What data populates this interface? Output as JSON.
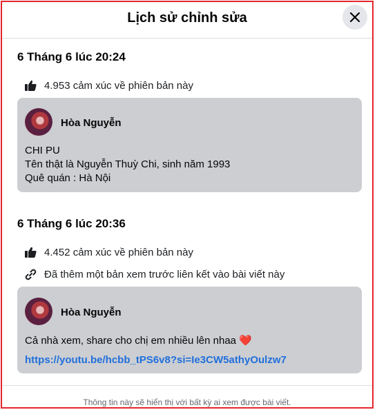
{
  "header": {
    "title": "Lịch sử chỉnh sửa",
    "close_icon": "close-icon"
  },
  "revisions": [
    {
      "date": "6 Tháng 6 lúc 20:24",
      "reactions": "4.953 cảm xúc về phiên bản này",
      "author": "Hòa Nguyễn",
      "lines": [
        "CHI PU",
        "Tên thật là Nguyễn Thuỳ Chi, sinh năm 1993",
        "Quê quán : Hà Nội"
      ]
    },
    {
      "date": "6 Tháng 6 lúc 20:36",
      "reactions": "4.452 cảm xúc về phiên bản này",
      "change_note": "Đã thêm một bản xem trước liên kết vào bài viết này",
      "author": "Hòa Nguyễn",
      "text": "Cả nhà xem, share cho chị em nhiều lên nhaa ❤️",
      "link": "https://youtu.be/hcbb_tPS6v8?si=Ie3CW5athyOulzw7"
    }
  ],
  "footer": {
    "note": "Thông tin này sẽ hiển thị với bất kỳ ai xem được bài viết."
  },
  "colors": {
    "accent_link": "#216fdb",
    "card_bg": "#ccced2",
    "border_red": "#e4262b"
  }
}
